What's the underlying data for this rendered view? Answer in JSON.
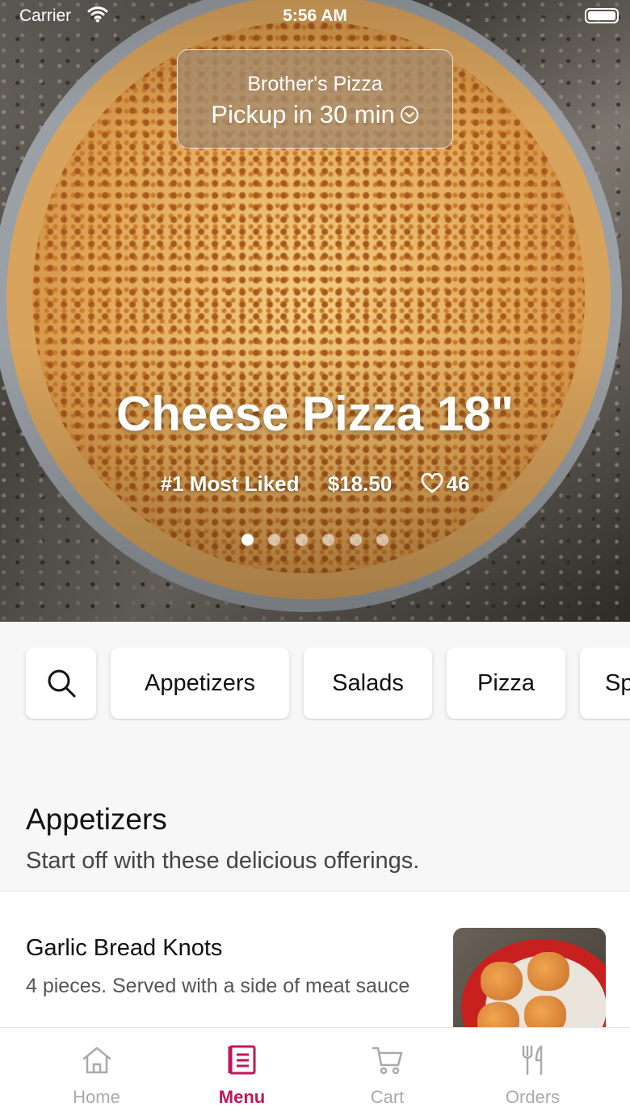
{
  "status_bar": {
    "carrier": "Carrier",
    "time": "5:56 AM"
  },
  "store": {
    "name": "Brother's Pizza",
    "pickup": "Pickup in 30 min"
  },
  "featured": {
    "title": "Cheese Pizza 18\"",
    "rank": "#1 Most Liked",
    "price": "$18.50",
    "likes": "46",
    "slides": 6,
    "active_slide": 1
  },
  "categories": [
    "Appetizers",
    "Salads",
    "Pizza",
    "Sp"
  ],
  "section": {
    "title": "Appetizers",
    "subtitle": "Start off with these delicious offerings."
  },
  "items": [
    {
      "name": "Garlic Bread Knots",
      "description": "4 pieces. Served with a side of meat sauce"
    }
  ],
  "tabs": [
    {
      "label": "Home",
      "icon": "home-icon",
      "active": false
    },
    {
      "label": "Menu",
      "icon": "menu-icon",
      "active": true
    },
    {
      "label": "Cart",
      "icon": "cart-icon",
      "active": false
    },
    {
      "label": "Orders",
      "icon": "fork-knife-icon",
      "active": false
    }
  ],
  "colors": {
    "accent": "#c4155a",
    "inactive": "#aaaaaa"
  }
}
